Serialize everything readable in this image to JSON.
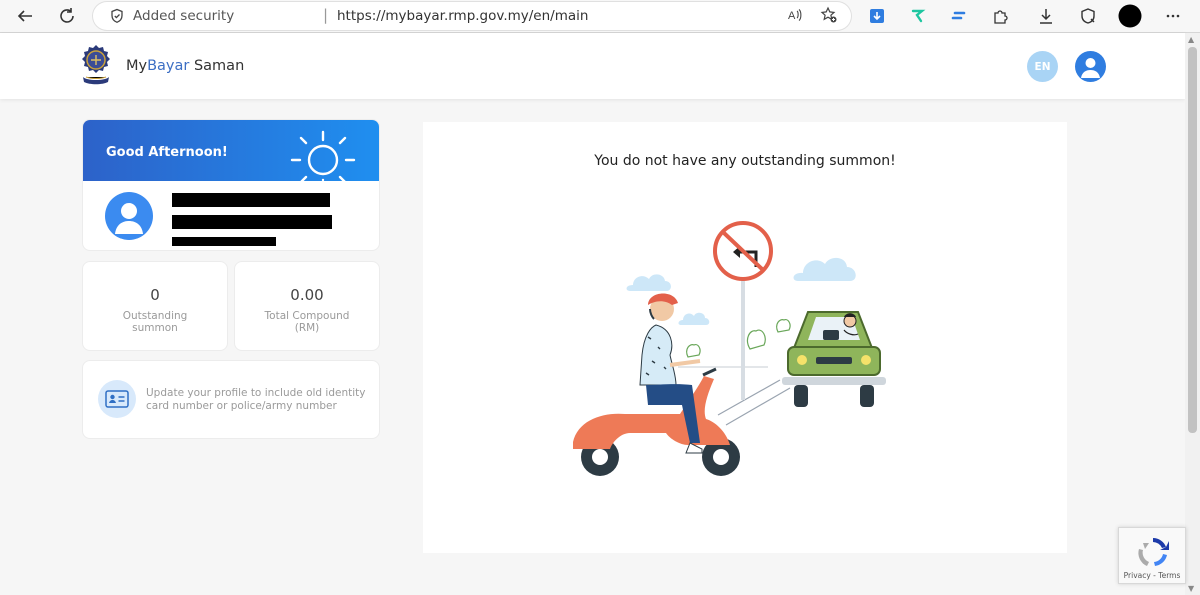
{
  "browser": {
    "security_label": "Added security",
    "separator": "|",
    "url": "https://mybayar.rmp.gov.my/en/main"
  },
  "header": {
    "brand_part1": "My",
    "brand_part2": "Bayar",
    "brand_part3": " Saman",
    "language": "EN"
  },
  "greeting": {
    "text": "Good Afternoon!"
  },
  "stats": {
    "outstanding_value": "0",
    "outstanding_label": "Outstanding summon",
    "compound_value": "0.00",
    "compound_label": "Total Compound (RM)"
  },
  "profile_prompt": {
    "text": "Update your profile to include old identity card number or police/army number"
  },
  "main": {
    "message": "You do not have any outstanding summon!"
  },
  "recaptcha": {
    "links": "Privacy - Terms"
  },
  "colors": {
    "brand_blue": "#3d6fc4",
    "banner_start": "#2d62c9",
    "banner_end": "#1f8ff0",
    "page_bg": "#f6f6f6"
  }
}
